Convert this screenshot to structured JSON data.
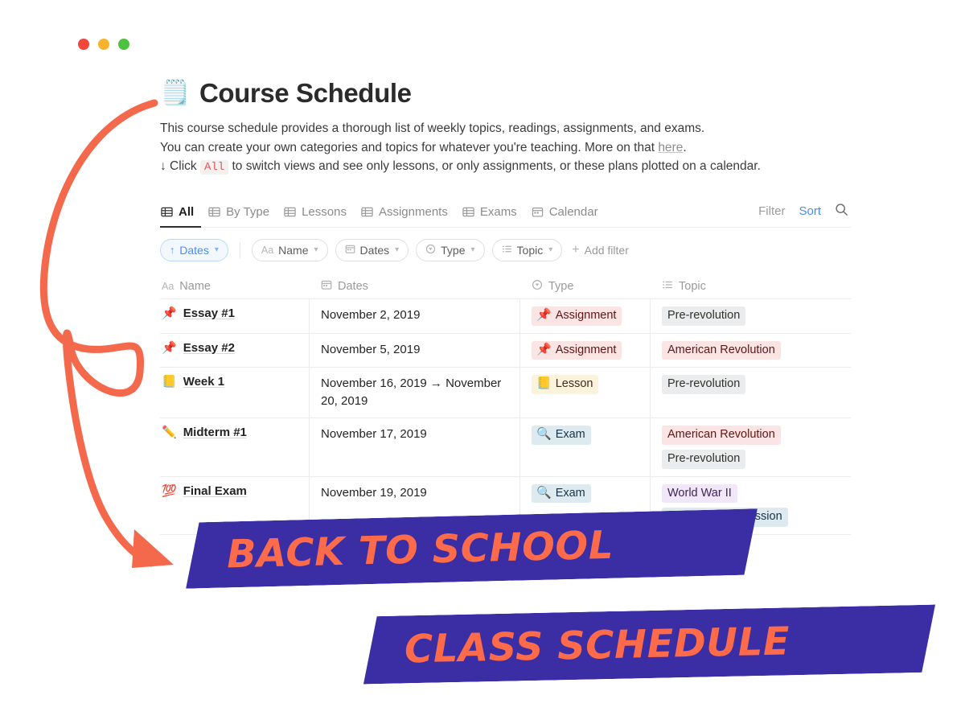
{
  "window": {
    "dots": [
      {
        "name": "close",
        "color": "#F0463C"
      },
      {
        "name": "minimize",
        "color": "#F7B32B"
      },
      {
        "name": "maximize",
        "color": "#4CC240"
      }
    ]
  },
  "doc": {
    "title_emoji": "🗒️",
    "title": "Course Schedule",
    "desc_line1": "This course schedule provides a thorough list of weekly topics, readings, assignments, and exams.",
    "desc_line2_pre": "You can create your own categories and topics for whatever you're teaching. More on that ",
    "desc_line2_link": "here",
    "desc_line2_post": ".",
    "desc_line3_pre": "↓ Click ",
    "desc_line3_code": "All",
    "desc_line3_post": " to switch views and see only lessons, or only assignments, or these plans plotted on a calendar."
  },
  "tabs": [
    {
      "label": "All",
      "icon": "table-icon",
      "active": true
    },
    {
      "label": "By Type",
      "icon": "table-icon",
      "active": false
    },
    {
      "label": "Lessons",
      "icon": "table-icon",
      "active": false
    },
    {
      "label": "Assignments",
      "icon": "table-icon",
      "active": false
    },
    {
      "label": "Exams",
      "icon": "table-icon",
      "active": false
    },
    {
      "label": "Calendar",
      "icon": "calendar-icon",
      "active": false
    }
  ],
  "toolbar": {
    "filter_label": "Filter",
    "sort_label": "Sort",
    "search_icon": "search-icon",
    "sort_color": "#4a8cf7"
  },
  "filters": {
    "sort_pill": {
      "prefix": "↑",
      "label": "Dates"
    },
    "pills": [
      {
        "prefix": "Aa",
        "label": "Name",
        "icon": "text-icon"
      },
      {
        "prefix": "",
        "label": "Dates",
        "icon": "calendar-icon"
      },
      {
        "prefix": "",
        "label": "Type",
        "icon": "select-icon"
      },
      {
        "prefix": "",
        "label": "Topic",
        "icon": "multiselect-icon"
      }
    ],
    "add_filter_label": "Add filter"
  },
  "table": {
    "columns": [
      {
        "key": "name",
        "label": "Name",
        "icon": "text-icon"
      },
      {
        "key": "dates",
        "label": "Dates",
        "icon": "calendar-icon"
      },
      {
        "key": "type",
        "label": "Type",
        "icon": "select-icon"
      },
      {
        "key": "topic",
        "label": "Topic",
        "icon": "multiselect-icon"
      }
    ],
    "rows": [
      {
        "name_emoji": "📌",
        "name": "Essay #1",
        "dates": "November 2, 2019",
        "type": {
          "emoji": "📌",
          "label": "Assignment",
          "style": "chip-assignment"
        },
        "topics": [
          {
            "label": "Pre-revolution",
            "style": "tag-grey"
          }
        ]
      },
      {
        "name_emoji": "📌",
        "name": "Essay #2",
        "dates": "November 5, 2019",
        "type": {
          "emoji": "📌",
          "label": "Assignment",
          "style": "chip-assignment"
        },
        "topics": [
          {
            "label": "American Revolution",
            "style": "tag-red"
          }
        ]
      },
      {
        "name_emoji": "📒",
        "name": "Week 1",
        "dates": "November 16, 2019 → November 20, 2019",
        "type": {
          "emoji": "📒",
          "label": "Lesson",
          "style": "chip-lesson"
        },
        "topics": [
          {
            "label": "Pre-revolution",
            "style": "tag-grey"
          }
        ]
      },
      {
        "name_emoji": "✏️",
        "name": "Midterm #1",
        "dates": "November 17, 2019",
        "type": {
          "emoji": "🔍",
          "label": "Exam",
          "style": "chip-exam"
        },
        "topics": [
          {
            "label": "American Revolution",
            "style": "tag-red"
          },
          {
            "label": "Pre-revolution",
            "style": "tag-grey"
          }
        ]
      },
      {
        "name_emoji": "💯",
        "name": "Final Exam",
        "dates": "November 19, 2019",
        "type": {
          "emoji": "🔍",
          "label": "Exam",
          "style": "chip-exam"
        },
        "topics": [
          {
            "label": "World War II",
            "style": "tag-purple"
          },
          {
            "label": "The Great Depression",
            "style": "tag-blue"
          }
        ]
      }
    ]
  },
  "banners": [
    {
      "text": "BACK TO SCHOOL",
      "bg": "#3B2EA5",
      "fg": "#FD6B4B"
    },
    {
      "text": "CLASS SCHEDULE",
      "bg": "#3B2EA5",
      "fg": "#FD6B4B"
    }
  ],
  "annotation": {
    "color": "#F4684C",
    "shape": "looping-curved-arrow"
  }
}
